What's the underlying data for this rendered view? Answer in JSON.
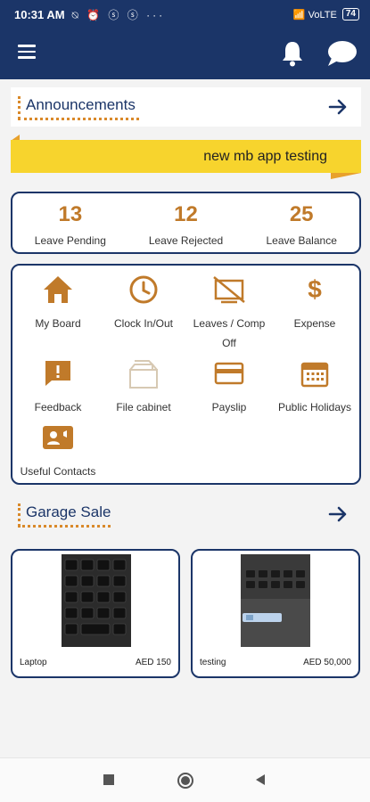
{
  "status_bar": {
    "time": "10:31 AM",
    "icons": "⍉ ⏰ ⓢ ⓢ ···",
    "signal": "📶 VoLTE",
    "battery": "74"
  },
  "app_bar": {
    "menu_icon": "hamburger-menu-icon",
    "notification_icon": "bell-icon",
    "chat_icon": "chat-bubble-icon"
  },
  "announcements": {
    "title": "Announcements",
    "banner_text": "new mb app testing"
  },
  "leave_stats": [
    {
      "value": "13",
      "label": "Leave Pending"
    },
    {
      "value": "12",
      "label": "Leave Rejected"
    },
    {
      "value": "25",
      "label": "Leave Balance"
    }
  ],
  "menu": [
    {
      "label": "My Board",
      "icon": "home-icon"
    },
    {
      "label": "Clock In/Out",
      "icon": "clock-icon"
    },
    {
      "label": "Leaves / Comp Off",
      "icon": "leave-icon"
    },
    {
      "label": "Expense",
      "icon": "dollar-icon"
    },
    {
      "label": "Feedback",
      "icon": "feedback-icon"
    },
    {
      "label": "File cabinet",
      "icon": "file-cabinet-icon"
    },
    {
      "label": "Payslip",
      "icon": "payslip-card-icon"
    },
    {
      "label": "Public Holidays",
      "icon": "calendar-icon"
    },
    {
      "label": "Useful Contacts",
      "icon": "contacts-icon"
    }
  ],
  "garage_sale": {
    "title": "Garage Sale",
    "items": [
      {
        "name": "Laptop",
        "price": "AED 150"
      },
      {
        "name": "testing",
        "price": "AED 50,000"
      }
    ]
  },
  "colors": {
    "primary": "#1b3568",
    "accent": "#c07a2a",
    "banner": "#f7d42d"
  }
}
